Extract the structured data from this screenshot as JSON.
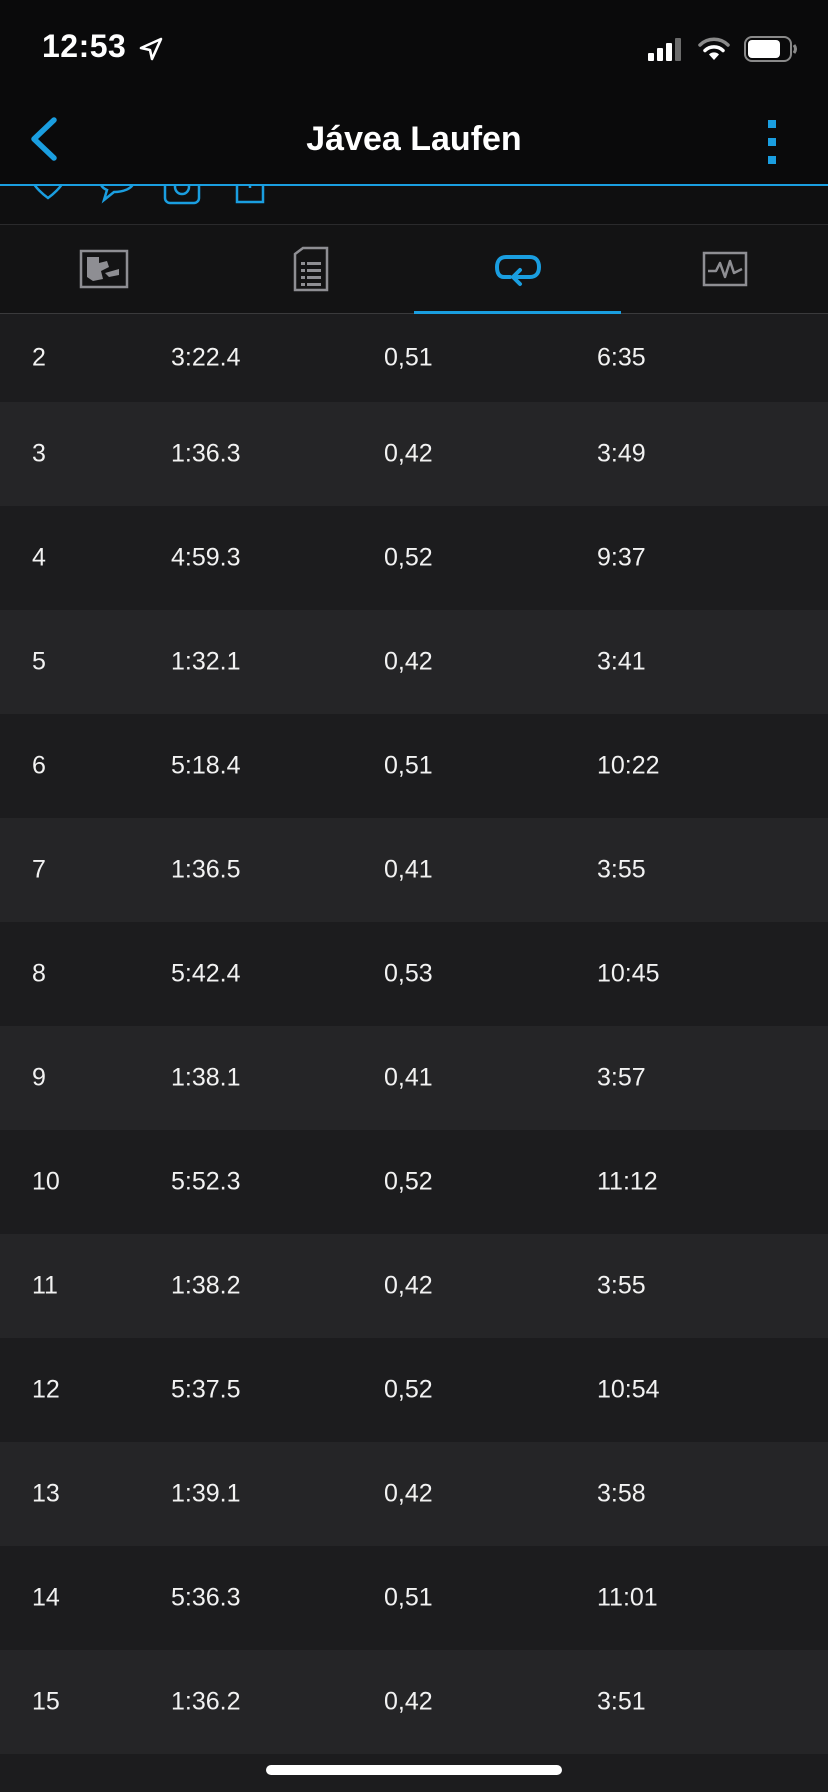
{
  "status": {
    "time": "12:53"
  },
  "header": {
    "title": "Jávea Laufen"
  },
  "tabs": [
    {
      "icon": "map-stats-icon"
    },
    {
      "icon": "details-list-icon"
    },
    {
      "icon": "laps-loop-icon",
      "active": true
    },
    {
      "icon": "chart-graph-icon"
    }
  ],
  "laps": [
    {
      "lap": "2",
      "time": "3:22.4",
      "distance": "0,51",
      "pace": "6:35"
    },
    {
      "lap": "3",
      "time": "1:36.3",
      "distance": "0,42",
      "pace": "3:49"
    },
    {
      "lap": "4",
      "time": "4:59.3",
      "distance": "0,52",
      "pace": "9:37"
    },
    {
      "lap": "5",
      "time": "1:32.1",
      "distance": "0,42",
      "pace": "3:41"
    },
    {
      "lap": "6",
      "time": "5:18.4",
      "distance": "0,51",
      "pace": "10:22"
    },
    {
      "lap": "7",
      "time": "1:36.5",
      "distance": "0,41",
      "pace": "3:55"
    },
    {
      "lap": "8",
      "time": "5:42.4",
      "distance": "0,53",
      "pace": "10:45"
    },
    {
      "lap": "9",
      "time": "1:38.1",
      "distance": "0,41",
      "pace": "3:57"
    },
    {
      "lap": "10",
      "time": "5:52.3",
      "distance": "0,52",
      "pace": "11:12"
    },
    {
      "lap": "11",
      "time": "1:38.2",
      "distance": "0,42",
      "pace": "3:55"
    },
    {
      "lap": "12",
      "time": "5:37.5",
      "distance": "0,52",
      "pace": "10:54"
    },
    {
      "lap": "13",
      "time": "1:39.1",
      "distance": "0,42",
      "pace": "3:58"
    },
    {
      "lap": "14",
      "time": "5:36.3",
      "distance": "0,51",
      "pace": "11:01"
    },
    {
      "lap": "15",
      "time": "1:36.2",
      "distance": "0,42",
      "pace": "3:51"
    }
  ],
  "colors": {
    "accent": "#1a9ee0",
    "background": "#1c1c1e",
    "row_alt": "#252527"
  }
}
